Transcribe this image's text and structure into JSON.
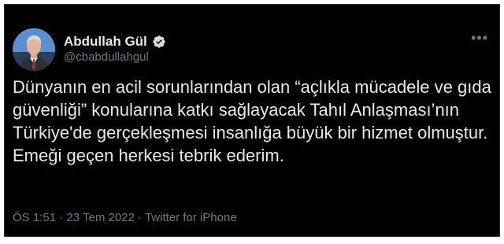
{
  "tweet": {
    "author": {
      "display_name": "Abdullah Gül",
      "handle": "@cbabdullahgul",
      "verified": true,
      "verified_icon": "verified-badge-icon",
      "avatar_icon": "profile-photo"
    },
    "more_icon": "more-options-icon",
    "text": "Dünyanın en acil sorunlarından olan “açlıkla mücadele ve gıda güvenliği” konularına katkı sağlayacak Tahıl Anlaşması’nın Türkiye'de gerçekleşmesi insanlığa büyük bir hizmet olmuştur. Emeği geçen herkesi tebrik ederim.",
    "time": "ÖS 1:51",
    "separator": "·",
    "date": "23 Tem 2022",
    "source": "Twitter for iPhone"
  },
  "colors": {
    "background": "#000000",
    "text": "#e7e9ea",
    "secondary_text": "#71767b",
    "verified_badge": "#d6d9db"
  }
}
